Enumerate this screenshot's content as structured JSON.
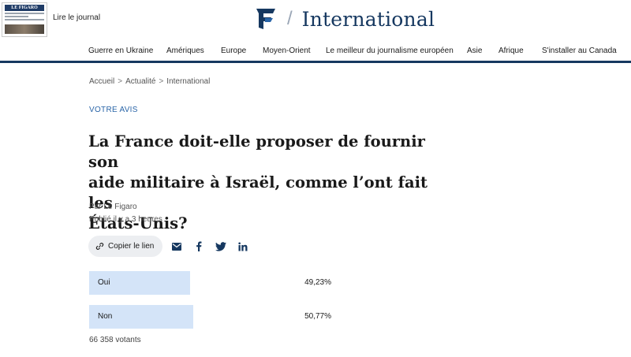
{
  "header": {
    "newspaper_thumb_masthead": "LE FIGARO",
    "read_journal_label": "Lire le journal",
    "section_title": "International",
    "slash": "/"
  },
  "nav": {
    "items": [
      {
        "label": "Guerre en Ukraine"
      },
      {
        "label": "Amériques"
      },
      {
        "label": "Europe"
      },
      {
        "label": "Moyen-Orient"
      },
      {
        "label": "Le meilleur du journalisme européen"
      },
      {
        "label": "Asie"
      },
      {
        "label": "Afrique"
      },
      {
        "label": "S'installer au Canada"
      }
    ]
  },
  "breadcrumb": {
    "items": [
      "Accueil",
      "Actualité",
      "International"
    ],
    "separator": ">"
  },
  "article": {
    "kicker": "VOTRE AVIS",
    "title_lines": [
      "La France doit-elle proposer de fournir son",
      "aide militaire à Israël, comme l’ont fait les",
      "États-Unis?"
    ],
    "byline": "Par Le Figaro",
    "published": "Publié il y a 3 heures"
  },
  "share": {
    "copy_link_label": "Copier le lien",
    "icons": [
      "link-icon",
      "mail-icon",
      "facebook-icon",
      "twitter-icon",
      "linkedin-icon"
    ]
  },
  "poll": {
    "options": [
      {
        "label": "Oui",
        "percent_text": "49,23%",
        "percent": 49.23
      },
      {
        "label": "Non",
        "percent_text": "50,77%",
        "percent": 50.77
      }
    ],
    "votes_text": "66 358 votants"
  },
  "colors": {
    "brand_navy": "#163860",
    "kicker_blue": "#2a65a8",
    "poll_bar": "#d4e4f8"
  }
}
